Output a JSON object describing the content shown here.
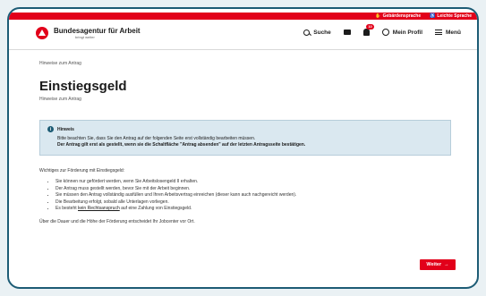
{
  "topbar": {
    "sign_language": "Gebärdensprache",
    "easy_language": "Leichte Sprache"
  },
  "header": {
    "brand": "Bundesagentur für Arbeit",
    "tagline": "bringt weiter",
    "search_label": "Suche",
    "notification_count": "10",
    "profile_label": "Mein Profil",
    "menu_label": "Menü"
  },
  "breadcrumb": "Hinweise zum Antrag",
  "page": {
    "title": "Einstiegsgeld",
    "subtitle": "Hinweise zum Antrag"
  },
  "notice": {
    "heading": "Hinweis",
    "line1": "Bitte beachten Sie, dass Sie den Antrag auf der folgenden Seite erst vollständig bearbeiten müssen.",
    "line2": "Der Antrag gilt erst als gestellt, wenn sie die Schaltfläche \"Antrag absenden\" auf der letzten Antragsseite bestätigen."
  },
  "body": {
    "intro": "Wichtiges zur Förderung mit Einstiegsgeld:",
    "bullets": [
      "Sie können nur gefördert werden, wenn Sie Arbeitslosengeld II erhalten.",
      "Der Antrag muss gestellt werden, bevor Sie mit der Arbeit beginnen.",
      "Sie müssen den Antrag vollständig ausfüllen und Ihren Arbeitsvertrag einreichen (dieser kann auch nachgereicht werden).",
      "Die Bearbeitung erfolgt, sobald alle Unterlagen vorliegen."
    ],
    "last_bullet_prefix": "Es besteht",
    "last_bullet_link": "kein Rechtsanspruch",
    "last_bullet_suffix": "auf eine Zahlung von Einstiegsgeld.",
    "closing": "Über die Dauer und die Höhe der Förderung entscheidet Ihr Jobcenter vor Ort."
  },
  "actions": {
    "next_label": "Weiter",
    "next_arrow": "→"
  },
  "colors": {
    "brand_red": "#e2001a",
    "notice_bg": "#dae8f0",
    "frame_border": "#1d5c75"
  }
}
